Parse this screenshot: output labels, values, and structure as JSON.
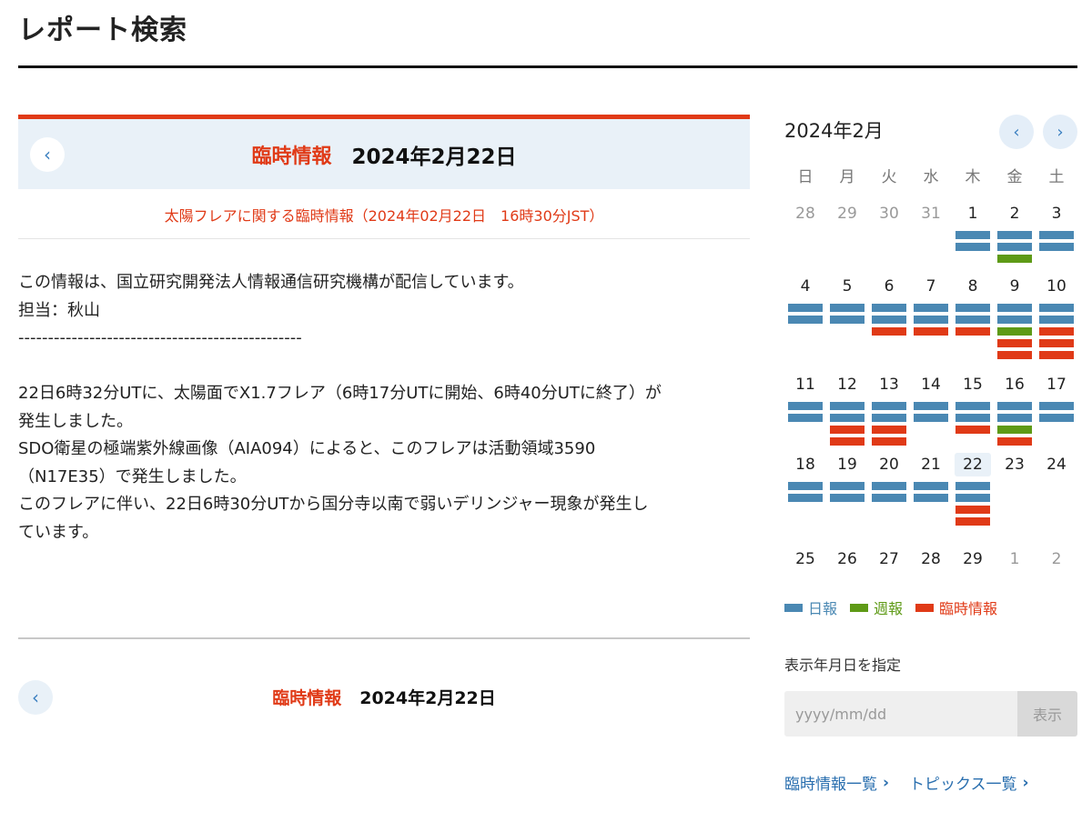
{
  "page": {
    "title": "レポート検索"
  },
  "report": {
    "kind": "臨時情報",
    "date": "2024年2月22日",
    "subtitle": "太陽フレアに関する臨時情報（2024年02月22日　16時30分JST）",
    "prev_icon": "chevron-left-icon",
    "lines": [
      "この情報は、国立研究開発法人情報通信研究機構が配信しています。",
      "担当：秋山",
      "------------------------------------------------",
      "",
      "22日6時32分UTに、太陽面でX1.7フレア（6時17分UTに開始、6時40分UTに終了）が",
      "発生しました。",
      "SDO衛星の極端紫外線画像（AIA094）によると、このフレアは活動領域3590",
      "（N17E35）で発生しました。",
      "このフレアに伴い、22日6時30分UTから国分寺以南で弱いデリンジャー現象が発生し",
      "ています。"
    ]
  },
  "bottom_nav": {
    "kind": "臨時情報",
    "date": "2024年2月22日",
    "prev_icon": "chevron-left-icon"
  },
  "calendar": {
    "month_label": "2024年2月",
    "prev_icon": "chevron-left-icon",
    "next_icon": "chevron-right-icon",
    "weekdays": [
      "日",
      "月",
      "火",
      "水",
      "木",
      "金",
      "土"
    ],
    "weeks": [
      [
        {
          "d": "28",
          "other": true,
          "bars": []
        },
        {
          "d": "29",
          "other": true,
          "bars": []
        },
        {
          "d": "30",
          "other": true,
          "bars": []
        },
        {
          "d": "31",
          "other": true,
          "bars": []
        },
        {
          "d": "1",
          "bars": [
            "daily",
            "daily"
          ]
        },
        {
          "d": "2",
          "bars": [
            "daily",
            "daily",
            "weekly"
          ]
        },
        {
          "d": "3",
          "bars": [
            "daily",
            "daily"
          ]
        }
      ],
      [
        {
          "d": "4",
          "bars": [
            "daily",
            "daily"
          ]
        },
        {
          "d": "5",
          "bars": [
            "daily",
            "daily"
          ]
        },
        {
          "d": "6",
          "bars": [
            "daily",
            "daily",
            "alert"
          ]
        },
        {
          "d": "7",
          "bars": [
            "daily",
            "daily",
            "alert"
          ]
        },
        {
          "d": "8",
          "bars": [
            "daily",
            "daily",
            "alert"
          ]
        },
        {
          "d": "9",
          "bars": [
            "daily",
            "daily",
            "weekly",
            "alert",
            "alert"
          ]
        },
        {
          "d": "10",
          "bars": [
            "daily",
            "daily",
            "alert",
            "alert",
            "alert"
          ]
        }
      ],
      [
        {
          "d": "11",
          "bars": [
            "daily",
            "daily"
          ]
        },
        {
          "d": "12",
          "bars": [
            "daily",
            "daily",
            "alert",
            "alert"
          ]
        },
        {
          "d": "13",
          "bars": [
            "daily",
            "daily",
            "alert",
            "alert"
          ]
        },
        {
          "d": "14",
          "bars": [
            "daily",
            "daily"
          ]
        },
        {
          "d": "15",
          "bars": [
            "daily",
            "daily",
            "alert"
          ]
        },
        {
          "d": "16",
          "bars": [
            "daily",
            "daily",
            "weekly",
            "alert"
          ]
        },
        {
          "d": "17",
          "bars": [
            "daily",
            "daily"
          ]
        }
      ],
      [
        {
          "d": "18",
          "bars": [
            "daily",
            "daily"
          ]
        },
        {
          "d": "19",
          "bars": [
            "daily",
            "daily"
          ]
        },
        {
          "d": "20",
          "bars": [
            "daily",
            "daily"
          ]
        },
        {
          "d": "21",
          "bars": [
            "daily",
            "daily"
          ]
        },
        {
          "d": "22",
          "today": true,
          "bars": [
            "daily",
            "daily",
            "alert",
            "alert"
          ]
        },
        {
          "d": "23",
          "bars": []
        },
        {
          "d": "24",
          "bars": []
        }
      ],
      [
        {
          "d": "25",
          "bars": []
        },
        {
          "d": "26",
          "bars": []
        },
        {
          "d": "27",
          "bars": []
        },
        {
          "d": "28",
          "bars": []
        },
        {
          "d": "29",
          "bars": []
        },
        {
          "d": "1",
          "other": true,
          "bars": []
        },
        {
          "d": "2",
          "other": true,
          "bars": []
        }
      ]
    ],
    "legend": [
      {
        "key": "daily",
        "label": "日報",
        "color": "#4a88b3"
      },
      {
        "key": "weekly",
        "label": "週報",
        "color": "#5e9a16"
      },
      {
        "key": "alert",
        "label": "臨時情報",
        "color": "#e03a17"
      }
    ]
  },
  "date_search": {
    "label": "表示年月日を指定",
    "placeholder": "yyyy/mm/dd",
    "value": "",
    "button": "表示"
  },
  "links": [
    {
      "label": "臨時情報一覧",
      "icon": "chevron-right-icon"
    },
    {
      "label": "トピックス一覧",
      "icon": "chevron-right-icon"
    }
  ]
}
